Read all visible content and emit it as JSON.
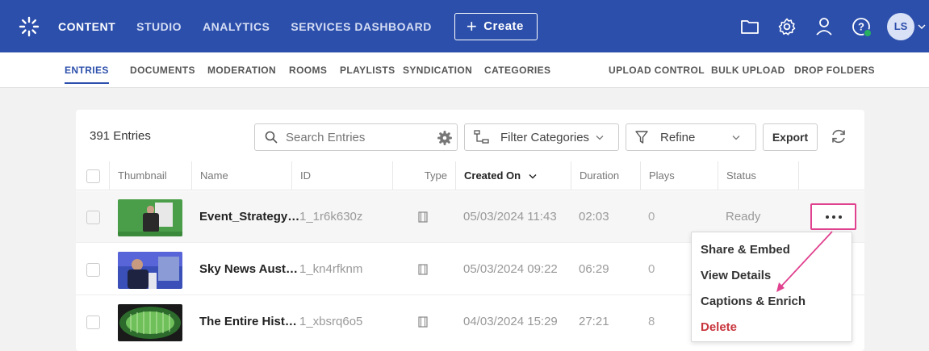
{
  "topnav": {
    "items": [
      "CONTENT",
      "STUDIO",
      "ANALYTICS",
      "SERVICES DASHBOARD"
    ],
    "create_label": "Create",
    "avatar_initials": "LS"
  },
  "subnav": {
    "left": [
      "ENTRIES",
      "DOCUMENTS",
      "MODERATION",
      "ROOMS",
      "PLAYLISTS",
      "SYNDICATION",
      "CATEGORIES"
    ],
    "right": [
      "UPLOAD CONTROL",
      "BULK UPLOAD",
      "DROP FOLDERS"
    ]
  },
  "toolbar": {
    "entries_count": "391 Entries",
    "search_placeholder": "Search Entries",
    "filter_categories": "Filter Categories",
    "refine": "Refine",
    "export": "Export"
  },
  "table": {
    "headers": [
      "Thumbnail",
      "Name",
      "ID",
      "Type",
      "Created On",
      "Duration",
      "Plays",
      "Status"
    ],
    "rows": [
      {
        "name": "Event_Strategy…",
        "id": "1_1r6k630z",
        "created": "05/03/2024 11:43",
        "duration": "02:03",
        "plays": "0",
        "status": "Ready"
      },
      {
        "name": "Sky News Aust…",
        "id": "1_kn4rfknm",
        "created": "05/03/2024 09:22",
        "duration": "06:29",
        "plays": "0",
        "status": ""
      },
      {
        "name": "The Entire Hist…",
        "id": "1_xbsrq6o5",
        "created": "04/03/2024 15:29",
        "duration": "27:21",
        "plays": "8",
        "status": ""
      }
    ]
  },
  "actions_menu": {
    "items": [
      "Share & Embed",
      "View Details",
      "Captions & Enrich",
      "Delete"
    ]
  },
  "colors": {
    "brand": "#2c4fab",
    "highlight": "#e0428f",
    "danger": "#c8353c"
  }
}
